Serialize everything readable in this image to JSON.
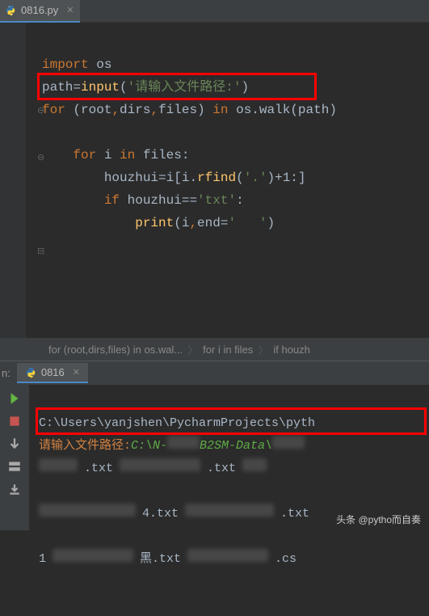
{
  "tab": {
    "filename": "0816.py"
  },
  "code": {
    "l1_kw": "import",
    "l1_mod": "os",
    "l2_id": "path",
    "l2_eq": "=",
    "l2_fn": "input",
    "l2_str": "'请输入文件路径:'",
    "l3_kw1": "for",
    "l3_p1": "(root",
    "l3_c1": ",",
    "l3_p2": "dirs",
    "l3_c2": ",",
    "l3_p3": "files)",
    "l3_kw2": "in",
    "l3_os": "os",
    "l3_dot": ".",
    "l3_walk": "walk",
    "l3_arg": "(path)",
    "l5_kw": "for",
    "l5_i": "i",
    "l5_in": "in",
    "l5_files": "files:",
    "l6_id": "houzhui",
    "l6_eq": "=",
    "l6_i": "i[i",
    "l6_dot": ".",
    "l6_fn": "rfind",
    "l6_arg": "(",
    "l6_str": "'.'",
    "l6_rest": ")+1:]",
    "l7_kw": "if",
    "l7_id": "houzhui",
    "l7_eq": "==",
    "l7_str": "'txt'",
    "l7_col": ":",
    "l8_fn": "print",
    "l8_arg": "(i",
    "l8_c": ",",
    "l8_end": "end",
    "l8_eq": "=",
    "l8_str": "'   '",
    "l8_close": ")"
  },
  "breadcrumb": {
    "b1": "for (root,dirs,files) in os.wal...",
    "b2": "for i in files",
    "b3": "if houzh"
  },
  "run": {
    "label": "n:",
    "tab": "0816"
  },
  "console": {
    "line1": "C:\\Users\\yanjshen\\PycharmProjects\\pyth",
    "prompt": "请输入文件路径:",
    "input_a": "C:\\N-",
    "input_b": "B2SM-Data\\",
    "ext_txt": ".txt",
    "row3_a": ".txt",
    "row3_b": ".txt",
    "row4_a": "4.txt",
    "row4_b": ".txt",
    "row5_num": "1",
    "row5_a": "黑.txt",
    "row5_b": ".cs"
  },
  "watermark": "头条 @pytho而自奏"
}
